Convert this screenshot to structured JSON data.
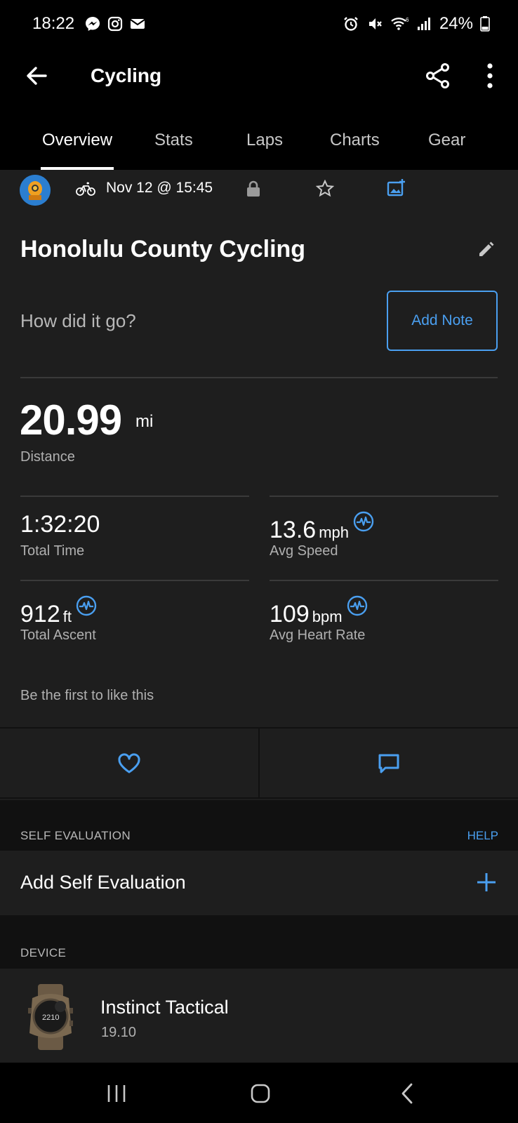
{
  "status_bar": {
    "time": "18:22",
    "battery": "24%",
    "left_icons": [
      "messenger-icon",
      "instagram-icon",
      "mail-icon"
    ],
    "right_icons": [
      "alarm-icon",
      "mute-icon",
      "wifi-icon",
      "signal-icon",
      "battery-icon"
    ]
  },
  "app_bar": {
    "title": "Cycling",
    "back_icon": "arrow-left-icon",
    "share_icon": "share-icon",
    "more_icon": "more-vert-icon"
  },
  "tabs": [
    {
      "label": "Overview",
      "active": true
    },
    {
      "label": "Stats",
      "active": false
    },
    {
      "label": "Laps",
      "active": false
    },
    {
      "label": "Charts",
      "active": false
    },
    {
      "label": "Gear",
      "active": false
    }
  ],
  "activity": {
    "date": "Nov 12 @ 15:45",
    "title": "Honolulu County Cycling",
    "prompt": "How did it go?",
    "add_note": "Add Note"
  },
  "distance": {
    "value": "20.99",
    "unit": "mi",
    "label": "Distance"
  },
  "stats": [
    {
      "value": "1:32:20",
      "unit": "",
      "label": "Total Time",
      "pulse": false
    },
    {
      "value": "13.6",
      "unit": "mph",
      "label": "Avg Speed",
      "pulse": true
    },
    {
      "value": "912",
      "unit": "ft",
      "label": "Total Ascent",
      "pulse": true
    },
    {
      "value": "109",
      "unit": "bpm",
      "label": "Avg Heart Rate",
      "pulse": true
    }
  ],
  "social": {
    "likes_text": "Be the first to like this"
  },
  "self_evaluation": {
    "header": "SELF EVALUATION",
    "help": "HELP",
    "row_label": "Add Self Evaluation"
  },
  "device": {
    "header": "DEVICE",
    "name": "Instinct Tactical",
    "version": "19.10",
    "watch_reading": "2210"
  },
  "colors": {
    "accent": "#4a9ff0",
    "background": "#1e1e1e",
    "section_band": "#111111",
    "header_bg": "#000000"
  }
}
